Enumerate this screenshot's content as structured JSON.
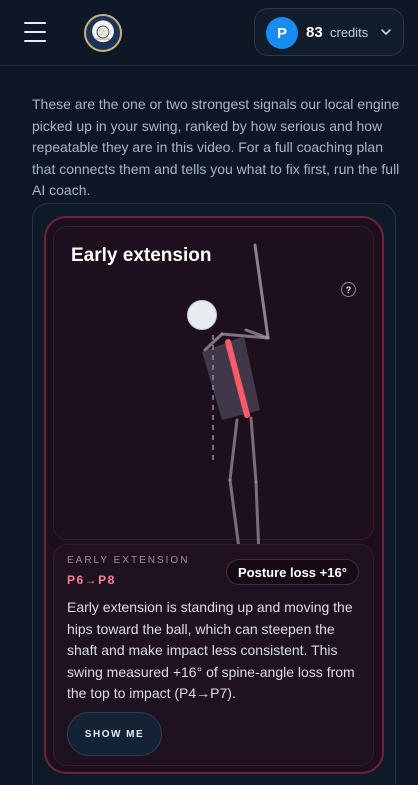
{
  "header": {
    "credits": {
      "avatar_initial": "P",
      "count": "83",
      "label": "credits"
    }
  },
  "intro": {
    "text": "These are the one or two strongest signals our local engine picked up in your swing, ranked by how serious and how repeatable they are in this video. For a full coaching plan that connects them and tells you what to fix first, run the full AI coach."
  },
  "finding": {
    "title": "Early extension",
    "help": "?",
    "kicker": "EARLY EXTENSION",
    "phase": "P6→P8",
    "metric": "Posture loss +16°",
    "description": "Early extension is standing up and moving the hips toward the ball, which can steepen the shaft and make impact less consistent. This swing measured +16° of spine-angle loss from the top to impact (P4→P7).",
    "button": "SHOW ME"
  },
  "colors": {
    "accent_pink": "#ff7c95",
    "spine_highlight": "#ff5a6a",
    "avatar_blue": "#1a8cf0",
    "card_border": "#6b2340"
  }
}
